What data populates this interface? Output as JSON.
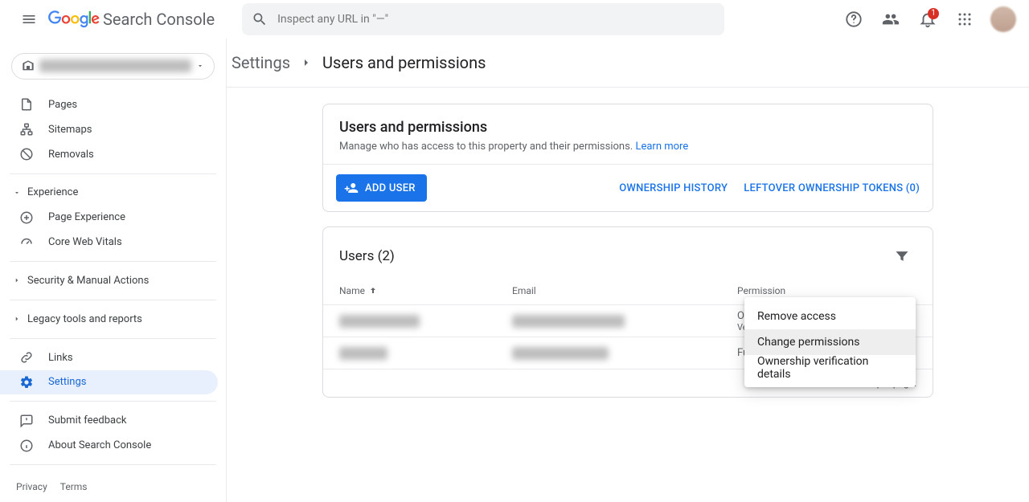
{
  "header": {
    "product_name": "Search Console",
    "search_placeholder": "Inspect any URL in \"—\"",
    "notification_count": "1"
  },
  "sidebar": {
    "items": {
      "pages": "Pages",
      "sitemaps": "Sitemaps",
      "removals": "Removals",
      "experience": "Experience",
      "page_experience": "Page Experience",
      "core_web_vitals": "Core Web Vitals",
      "security": "Security & Manual Actions",
      "legacy": "Legacy tools and reports",
      "links": "Links",
      "settings": "Settings",
      "feedback": "Submit feedback",
      "about": "About Search Console"
    },
    "footer": {
      "privacy": "Privacy",
      "terms": "Terms"
    }
  },
  "breadcrumb": {
    "parent": "Settings",
    "current": "Users and permissions"
  },
  "card1": {
    "title": "Users and permissions",
    "subtitle": "Manage who has access to this property and their permissions.",
    "learn_more": "Learn more",
    "add_user": "ADD USER",
    "ownership_history": "OWNERSHIP HISTORY",
    "leftover": "LEFTOVER OWNERSHIP TOKENS (0)"
  },
  "table": {
    "title": "Users (2)",
    "cols": {
      "name": "Name",
      "email": "Email",
      "perm": "Permission"
    },
    "row1_perm_main": "Owner",
    "row1_perm_sub": "Verified",
    "row2_perm": "Full",
    "footer_label": "Rows per page:"
  },
  "menu": {
    "remove": "Remove access",
    "change": "Change permissions",
    "verify": "Ownership verification details"
  }
}
